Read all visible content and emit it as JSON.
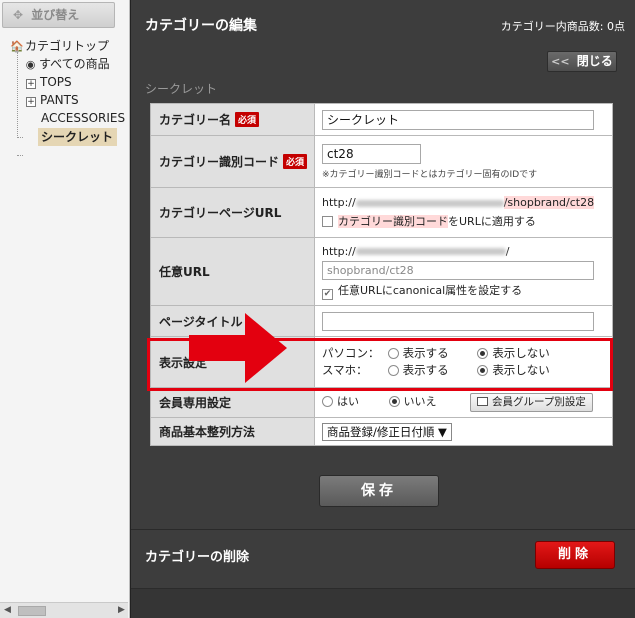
{
  "sidebar": {
    "sort_button": "並び替え",
    "tree": {
      "root": "カテゴリトップ",
      "items": [
        "すべての商品",
        "TOPS",
        "PANTS",
        "ACCESSORIES",
        "シークレット"
      ]
    }
  },
  "header": {
    "title": "カテゴリーの編集",
    "item_count": "カテゴリー内商品数: 0点",
    "close_button": "閉じる"
  },
  "section_label": "シークレット",
  "form": {
    "name": {
      "label": "カテゴリー名",
      "required": "必須",
      "value": "シークレット"
    },
    "code": {
      "label": "カテゴリー識別コード",
      "required": "必須",
      "value": "ct28",
      "note": "※カテゴリー識別コードとはカテゴリー固有のIDです"
    },
    "page_url": {
      "label": "カテゴリーページURL",
      "prefix": "http://",
      "suffix": "/shopbrand/ct28",
      "checkbox_highlight": "カテゴリー識別コード",
      "checkbox_rest": "をURLに適用する"
    },
    "custom_url": {
      "label": "任意URL",
      "prefix": "http://",
      "suffix": "/",
      "placeholder": "shopbrand/ct28",
      "checkbox": "任意URLにcanonical属性を設定する"
    },
    "page_title": {
      "label": "ページタイトル",
      "value": ""
    },
    "display": {
      "label": "表示設定",
      "pc_label": "パソコン：",
      "sp_label": "スマホ：",
      "show": "表示する",
      "hide": "表示しない"
    },
    "member": {
      "label": "会員専用設定",
      "yes": "はい",
      "no": "いいえ",
      "group_button": "会員グループ別設定"
    },
    "sort": {
      "label": "商品基本整列方法",
      "selected": "商品登録/修正日付順 ▼"
    }
  },
  "save_button": "保存",
  "delete": {
    "title": "カテゴリーの削除",
    "button": "削除"
  },
  "colors": {
    "highlight": "#e3000f",
    "required": "#c40000",
    "delete": "#d30000",
    "panel": "#3d3d3d"
  }
}
